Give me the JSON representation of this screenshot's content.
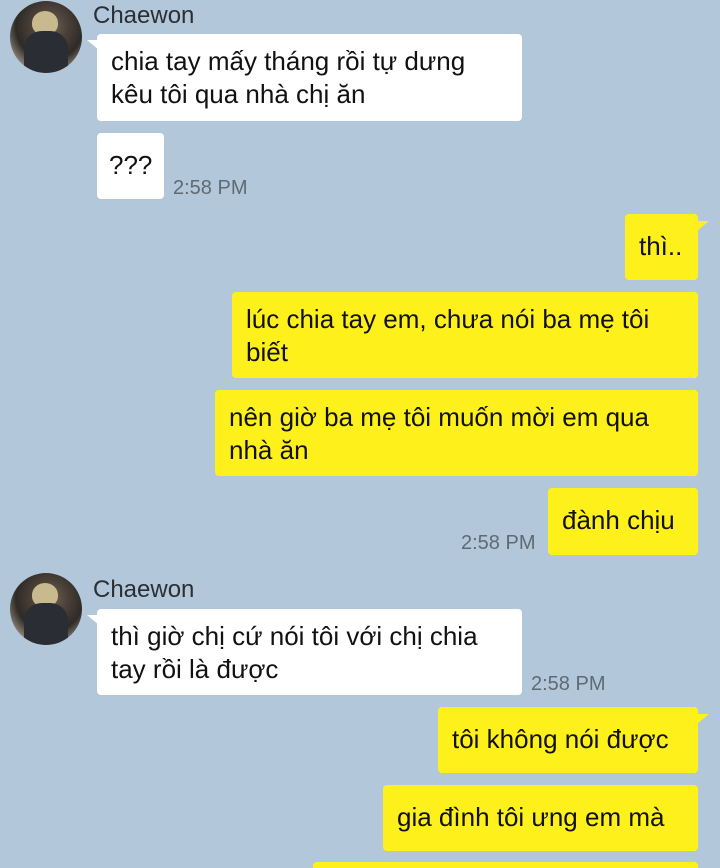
{
  "messages": [
    {
      "sender": "Chaewon",
      "text": "chia tay mấy tháng rồi tự dưng kêu tôi qua nhà chị ăn"
    },
    {
      "text": "???",
      "time": "2:58 PM"
    },
    {
      "text": "thì.."
    },
    {
      "text": "lúc chia tay em, chưa nói ba mẹ tôi biết"
    },
    {
      "text": "nên giờ ba mẹ tôi muốn mời em qua nhà ăn"
    },
    {
      "text": "đành chịu",
      "time": "2:58 PM"
    },
    {
      "sender": "Chaewon",
      "text": "thì giờ chị cứ nói tôi với chị chia tay rồi là được",
      "time": "2:58 PM"
    },
    {
      "text": "tôi không nói được"
    },
    {
      "text": "gia đình tôi ưng em mà"
    }
  ]
}
